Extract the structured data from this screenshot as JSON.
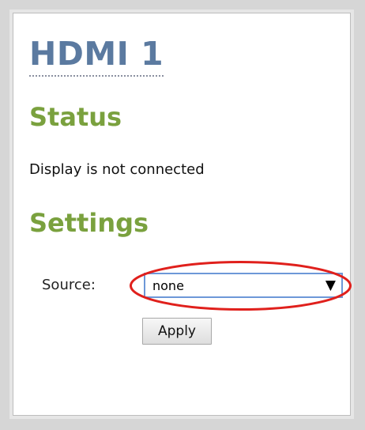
{
  "page": {
    "title": "HDMI 1"
  },
  "status": {
    "heading": "Status",
    "text": "Display is not connected"
  },
  "settings": {
    "heading": "Settings",
    "source_label": "Source:",
    "source_value": "none",
    "dropdown_arrow": "▼",
    "apply_label": "Apply"
  },
  "colors": {
    "title": "#5b7aa0",
    "headings": "#7aa13e",
    "highlight": "#e0201c",
    "select_border": "#6d98d8"
  },
  "icons": {
    "dropdown": "chevron-down-icon"
  }
}
